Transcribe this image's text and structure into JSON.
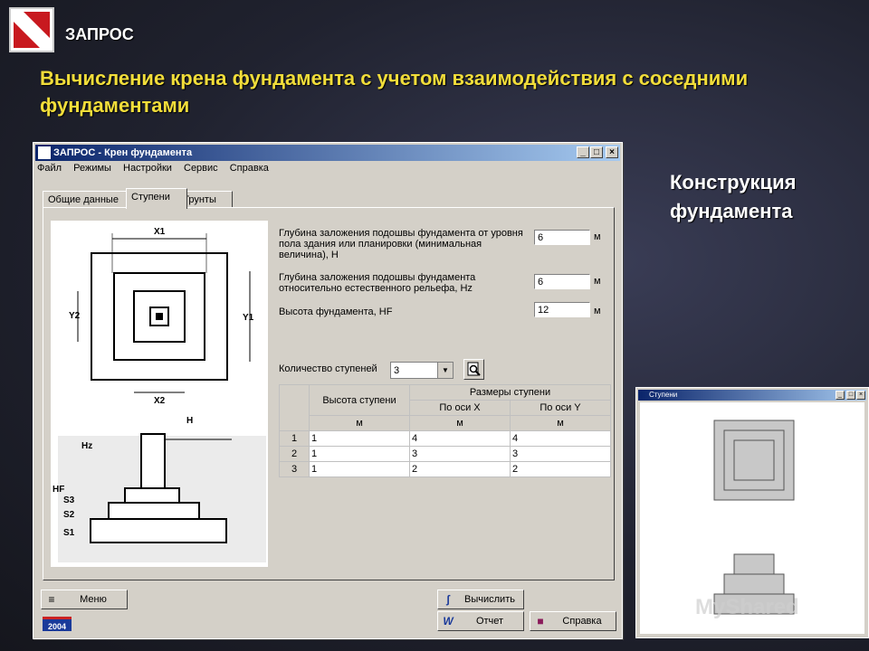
{
  "slide": {
    "logo_label": "ЗАПРОС",
    "heading": "Вычисление крена фундамента с учетом взаимодействия с соседними фундаментами",
    "caption": "Конструкция фундамента",
    "watermark": "MyShared"
  },
  "window": {
    "title": "ЗАПРОС - Крен фундамента",
    "controls": [
      "_",
      "□",
      "×"
    ]
  },
  "menu": [
    "Файл",
    "Режимы",
    "Настройки",
    "Сервис",
    "Справка"
  ],
  "tabs": [
    {
      "label": "Общие данные",
      "active": false
    },
    {
      "label": "Ступени",
      "active": true
    },
    {
      "label": "Грунты",
      "active": false
    }
  ],
  "drawing_labels": {
    "x1": "X1",
    "x2": "X2",
    "y1": "Y1",
    "y2": "Y2",
    "h": "H",
    "hz": "Hz",
    "hf": "HF",
    "s1": "S1",
    "s2": "S2",
    "s3": "S3"
  },
  "fields": [
    {
      "label": "Глубина заложения подошвы фундамента от уровня пола здания или планировки (минимальная величина), H",
      "value": "6",
      "unit": "м"
    },
    {
      "label": "Глубина заложения подошвы фундамента относительно естественного рельефа, Hz",
      "value": "6",
      "unit": "м"
    },
    {
      "label": "Высота фундамента, HF",
      "value": "12",
      "unit": "м"
    }
  ],
  "steps_count": {
    "label": "Количество ступеней",
    "value": "3"
  },
  "table": {
    "col_height": "Высота ступени",
    "col_sizes": "Размеры ступени",
    "col_x": "По оси X",
    "col_y": "По оси Y",
    "unit": "м",
    "rows": [
      {
        "n": "1",
        "h": "1",
        "x": "4",
        "y": "4"
      },
      {
        "n": "2",
        "h": "1",
        "x": "3",
        "y": "3"
      },
      {
        "n": "3",
        "h": "1",
        "x": "2",
        "y": "2"
      }
    ]
  },
  "buttons": {
    "menu": "Меню",
    "calc": "Вычислить",
    "report": "Отчет",
    "help": "Справка",
    "version": "2004"
  },
  "preview": {
    "title": "Ступени",
    "controls": [
      "_",
      "□",
      "×"
    ]
  }
}
